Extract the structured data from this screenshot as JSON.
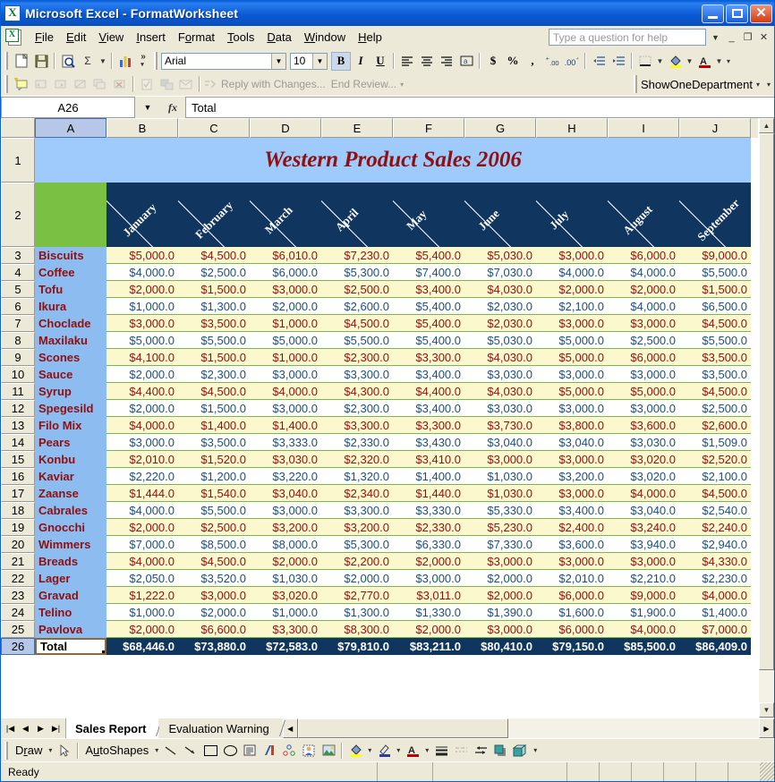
{
  "window": {
    "title": "Microsoft Excel - FormatWorksheet",
    "app_icon": "excel-icon",
    "minimize": "minimize-icon",
    "restore": "restore-icon",
    "close": "close-icon"
  },
  "menubar": {
    "items": [
      "File",
      "Edit",
      "View",
      "Insert",
      "Format",
      "Tools",
      "Data",
      "Window",
      "Help"
    ],
    "help_search_placeholder": "Type a question for help"
  },
  "standard_toolbar": {
    "buttons": [
      "new-icon",
      "save-icon",
      "print-preview-icon",
      "autosum-icon",
      "chart-wizard-icon"
    ],
    "overflow": "toolbar-options-icon"
  },
  "formatting_toolbar": {
    "font_name": "Arial",
    "font_size": "10",
    "bold": "B",
    "italic": "I",
    "underline": "U",
    "align_left": "align-left-icon",
    "align_center": "align-center-icon",
    "align_right": "align-right-icon",
    "merge_center": "merge-center-icon",
    "currency": "$",
    "percent": "%",
    "comma": ",",
    "increase_decimal": "+.0",
    "decrease_decimal": ".00",
    "decrease_indent": "decrease-indent-icon",
    "increase_indent": "increase-indent-icon",
    "borders": "borders-icon",
    "fill_color": "fill-color-icon",
    "font_color": "font-color-icon"
  },
  "reviewing_toolbar": {
    "reply_with_changes": "Reply with Changes...",
    "end_review": "End Review...",
    "macro_name": "ShowOneDepartment"
  },
  "formula_bar": {
    "name_box": "A26",
    "fx_label": "fx",
    "content": "Total"
  },
  "grid": {
    "columns": [
      "A",
      "B",
      "C",
      "D",
      "E",
      "F",
      "G",
      "H",
      "I",
      "J"
    ],
    "selected_column": "A",
    "selected_row": "26",
    "sheet_title": "Western Product Sales 2006",
    "months": [
      "January",
      "February",
      "March",
      "April",
      "May",
      "June",
      "July",
      "August",
      "September"
    ],
    "row_numbers": [
      "1",
      "2",
      "3",
      "4",
      "5",
      "6",
      "7",
      "8",
      "9",
      "10",
      "11",
      "12",
      "13",
      "14",
      "15",
      "16",
      "17",
      "18",
      "19",
      "20",
      "21",
      "22",
      "23",
      "24",
      "25",
      "26"
    ],
    "total_label": "Total",
    "colors": {
      "title_fill": "#9ecafc",
      "title_text": "#8f1010",
      "header_fill": "#10355e",
      "corner_fill": "#7ac143",
      "label_fill": "#8cbcf0",
      "label_text": "#8f1010",
      "band_odd_fill": "#fbf8cd",
      "band_odd_text": "#8f1010",
      "band_even_fill": "#ffffff",
      "band_even_text": "#1f4e79",
      "row_border": "#7ab648",
      "total_fill": "#10355e",
      "total_text": "#ffffff"
    }
  },
  "chart_data": {
    "type": "table",
    "title": "Western Product Sales 2006",
    "categories": [
      "January",
      "February",
      "March",
      "April",
      "May",
      "June",
      "July",
      "August",
      "September"
    ],
    "products": [
      "Biscuits",
      "Coffee",
      "Tofu",
      "Ikura",
      "Choclade",
      "Maxilaku",
      "Scones",
      "Sauce",
      "Syrup",
      "Spegesild",
      "Filo Mix",
      "Pears",
      "Konbu",
      "Kaviar",
      "Zaanse",
      "Cabrales",
      "Gnocchi",
      "Wimmers",
      "Breads",
      "Lager",
      "Gravad",
      "Telino",
      "Pavlova"
    ],
    "rows": [
      {
        "row": "3",
        "label": "Biscuits",
        "values": [
          "$5,000.0",
          "$4,500.0",
          "$6,010.0",
          "$7,230.0",
          "$5,400.0",
          "$5,030.0",
          "$3,000.0",
          "$6,000.0",
          "$9,000.0"
        ]
      },
      {
        "row": "4",
        "label": "Coffee",
        "values": [
          "$4,000.0",
          "$2,500.0",
          "$6,000.0",
          "$5,300.0",
          "$7,400.0",
          "$7,030.0",
          "$4,000.0",
          "$4,000.0",
          "$5,500.0"
        ]
      },
      {
        "row": "5",
        "label": "Tofu",
        "values": [
          "$2,000.0",
          "$1,500.0",
          "$3,000.0",
          "$2,500.0",
          "$3,400.0",
          "$4,030.0",
          "$2,000.0",
          "$2,000.0",
          "$1,500.0"
        ]
      },
      {
        "row": "6",
        "label": "Ikura",
        "values": [
          "$1,000.0",
          "$1,300.0",
          "$2,000.0",
          "$2,600.0",
          "$5,400.0",
          "$2,030.0",
          "$2,100.0",
          "$4,000.0",
          "$6,500.0"
        ]
      },
      {
        "row": "7",
        "label": "Choclade",
        "values": [
          "$3,000.0",
          "$3,500.0",
          "$1,000.0",
          "$4,500.0",
          "$5,400.0",
          "$2,030.0",
          "$3,000.0",
          "$3,000.0",
          "$4,500.0"
        ]
      },
      {
        "row": "8",
        "label": "Maxilaku",
        "values": [
          "$5,000.0",
          "$5,500.0",
          "$5,000.0",
          "$5,500.0",
          "$5,400.0",
          "$5,030.0",
          "$5,000.0",
          "$2,500.0",
          "$5,500.0"
        ]
      },
      {
        "row": "9",
        "label": "Scones",
        "values": [
          "$4,100.0",
          "$1,500.0",
          "$1,000.0",
          "$2,300.0",
          "$3,300.0",
          "$4,030.0",
          "$5,000.0",
          "$6,000.0",
          "$3,500.0"
        ]
      },
      {
        "row": "10",
        "label": "Sauce",
        "values": [
          "$2,000.0",
          "$2,300.0",
          "$3,000.0",
          "$3,300.0",
          "$3,400.0",
          "$3,030.0",
          "$3,000.0",
          "$3,000.0",
          "$3,500.0"
        ]
      },
      {
        "row": "11",
        "label": "Syrup",
        "values": [
          "$4,400.0",
          "$4,500.0",
          "$4,000.0",
          "$4,300.0",
          "$4,400.0",
          "$4,030.0",
          "$5,000.0",
          "$5,000.0",
          "$4,500.0"
        ]
      },
      {
        "row": "12",
        "label": "Spegesild",
        "values": [
          "$2,000.0",
          "$1,500.0",
          "$3,000.0",
          "$2,300.0",
          "$3,400.0",
          "$3,030.0",
          "$3,000.0",
          "$3,000.0",
          "$2,500.0"
        ]
      },
      {
        "row": "13",
        "label": "Filo Mix",
        "values": [
          "$4,000.0",
          "$1,400.0",
          "$1,400.0",
          "$3,300.0",
          "$3,300.0",
          "$3,730.0",
          "$3,800.0",
          "$3,600.0",
          "$2,600.0"
        ]
      },
      {
        "row": "14",
        "label": "Pears",
        "values": [
          "$3,000.0",
          "$3,500.0",
          "$3,333.0",
          "$2,330.0",
          "$3,430.0",
          "$3,040.0",
          "$3,040.0",
          "$3,030.0",
          "$1,509.0"
        ]
      },
      {
        "row": "15",
        "label": "Konbu",
        "values": [
          "$2,010.0",
          "$1,520.0",
          "$3,030.0",
          "$2,320.0",
          "$3,410.0",
          "$3,000.0",
          "$3,000.0",
          "$3,020.0",
          "$2,520.0"
        ]
      },
      {
        "row": "16",
        "label": "Kaviar",
        "values": [
          "$2,220.0",
          "$1,200.0",
          "$3,220.0",
          "$1,320.0",
          "$1,400.0",
          "$1,030.0",
          "$3,200.0",
          "$3,020.0",
          "$2,100.0"
        ]
      },
      {
        "row": "17",
        "label": "Zaanse",
        "values": [
          "$1,444.0",
          "$1,540.0",
          "$3,040.0",
          "$2,340.0",
          "$1,440.0",
          "$1,030.0",
          "$3,000.0",
          "$4,000.0",
          "$4,500.0"
        ]
      },
      {
        "row": "18",
        "label": "Cabrales",
        "values": [
          "$4,000.0",
          "$5,500.0",
          "$3,000.0",
          "$3,300.0",
          "$3,330.0",
          "$5,330.0",
          "$3,400.0",
          "$3,040.0",
          "$2,540.0"
        ]
      },
      {
        "row": "19",
        "label": "Gnocchi",
        "values": [
          "$2,000.0",
          "$2,500.0",
          "$3,200.0",
          "$3,200.0",
          "$2,330.0",
          "$5,230.0",
          "$2,400.0",
          "$3,240.0",
          "$2,240.0"
        ]
      },
      {
        "row": "20",
        "label": "Wimmers",
        "values": [
          "$7,000.0",
          "$8,500.0",
          "$8,000.0",
          "$5,300.0",
          "$6,330.0",
          "$7,330.0",
          "$3,600.0",
          "$3,940.0",
          "$2,940.0"
        ]
      },
      {
        "row": "21",
        "label": "Breads",
        "values": [
          "$4,000.0",
          "$4,500.0",
          "$2,000.0",
          "$2,200.0",
          "$2,000.0",
          "$3,000.0",
          "$3,000.0",
          "$3,000.0",
          "$4,330.0"
        ]
      },
      {
        "row": "22",
        "label": "Lager",
        "values": [
          "$2,050.0",
          "$3,520.0",
          "$1,030.0",
          "$2,000.0",
          "$3,000.0",
          "$2,000.0",
          "$2,010.0",
          "$2,210.0",
          "$2,230.0"
        ]
      },
      {
        "row": "23",
        "label": "Gravad",
        "values": [
          "$1,222.0",
          "$3,000.0",
          "$3,020.0",
          "$2,770.0",
          "$3,011.0",
          "$2,000.0",
          "$6,000.0",
          "$9,000.0",
          "$4,000.0"
        ]
      },
      {
        "row": "24",
        "label": "Telino",
        "values": [
          "$1,000.0",
          "$2,000.0",
          "$1,000.0",
          "$1,300.0",
          "$1,330.0",
          "$1,390.0",
          "$1,600.0",
          "$1,900.0",
          "$1,400.0"
        ]
      },
      {
        "row": "25",
        "label": "Pavlova",
        "values": [
          "$2,000.0",
          "$6,600.0",
          "$3,300.0",
          "$8,300.0",
          "$2,000.0",
          "$3,000.0",
          "$6,000.0",
          "$4,000.0",
          "$7,000.0"
        ]
      }
    ],
    "total_row": {
      "row": "26",
      "label": "Total",
      "values": [
        "$68,446.0",
        "$73,880.0",
        "$72,583.0",
        "$79,810.0",
        "$83,211.0",
        "$80,410.0",
        "$79,150.0",
        "$85,500.0",
        "$86,409.0"
      ]
    }
  },
  "sheet_tabs": {
    "first_icon": "first-sheet-icon",
    "prev_icon": "prev-sheet-icon",
    "next_icon": "next-sheet-icon",
    "last_icon": "last-sheet-icon",
    "tabs": [
      "Sales Report",
      "Evaluation Warning"
    ],
    "active": "Sales Report"
  },
  "drawing_toolbar": {
    "draw_label": "Draw",
    "select_icon": "select-objects-icon",
    "autoshapes_label": "AutoShapes",
    "line_icon": "line-icon",
    "arrow_icon": "arrow-icon",
    "rectangle_icon": "rectangle-icon",
    "oval_icon": "oval-icon",
    "textbox_icon": "text-box-icon",
    "wordart_icon": "wordart-icon",
    "diagram_icon": "diagram-icon",
    "clipart_icon": "clip-art-icon",
    "picture_icon": "insert-picture-icon",
    "fill_icon": "fill-color-icon",
    "line_color_icon": "line-color-icon",
    "font_color_icon": "font-color-icon",
    "line_style_icon": "line-style-icon",
    "dash_style_icon": "dash-style-icon",
    "arrow_style_icon": "arrow-style-icon",
    "shadow_icon": "shadow-style-icon",
    "threed_icon": "3d-style-icon"
  },
  "status_bar": {
    "text": "Ready"
  }
}
